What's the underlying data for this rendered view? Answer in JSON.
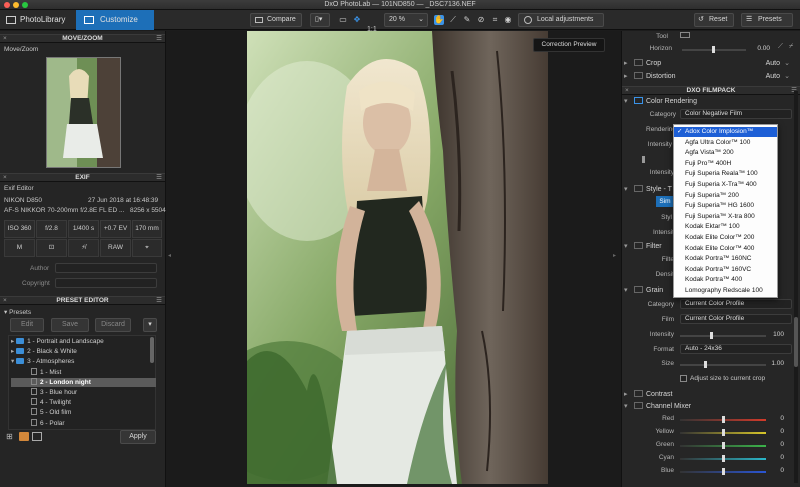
{
  "window": {
    "title": "DxO PhotoLab — 101ND850 — _DSC7136.NEF"
  },
  "toolbar": {
    "tab_library": "PhotoLibrary",
    "tab_customize": "Customize",
    "compare_label": "Compare",
    "zoom_fit": "1:1",
    "zoom_value": "20 %",
    "local_adjustments_label": "Local adjustments",
    "reset_label": "Reset",
    "presets_label": "Presets"
  },
  "move_zoom": {
    "header": "MOVE/ZOOM",
    "label": "Move/Zoom"
  },
  "exif": {
    "header": "EXIF",
    "editor_label": "Exif Editor",
    "camera": "NIKON D850",
    "date": "27 Jun 2018 at 16:48:39",
    "lens": "AF-S NIKKOR 70-200mm f/2.8E FL ED ...",
    "dimensions": "8256 x 5504",
    "iso": "ISO 360",
    "aperture": "f/2.8",
    "shutter": "1/400 s",
    "ev": "+0.7 EV",
    "focal": "170 mm",
    "mode_m": "M",
    "raw": "RAW",
    "author_label": "Author",
    "copyright_label": "Copyright"
  },
  "preset_editor": {
    "header": "PRESET EDITOR",
    "presets_label": "Presets",
    "edit_label": "Edit",
    "save_label": "Save",
    "discard_label": "Discard",
    "apply_label": "Apply",
    "tree": [
      {
        "label": "1 - Portrait and Landscape",
        "type": "folder",
        "expanded": false
      },
      {
        "label": "2 - Black & White",
        "type": "folder",
        "expanded": false
      },
      {
        "label": "3 - Atmospheres",
        "type": "folder",
        "expanded": true
      },
      {
        "label": "1 - Mist",
        "type": "preset"
      },
      {
        "label": "2 - London night",
        "type": "preset",
        "selected": true
      },
      {
        "label": "3 - Blue hour",
        "type": "preset"
      },
      {
        "label": "4 - Twilight",
        "type": "preset"
      },
      {
        "label": "5 - Old film",
        "type": "preset"
      },
      {
        "label": "6 - Polar",
        "type": "preset"
      }
    ]
  },
  "center": {
    "tooltip": "Correction Preview"
  },
  "right_panel": {
    "tool_label": "Tool",
    "horizon_label": "Horizon",
    "horizon_value": "0.00",
    "crop_label": "Crop",
    "crop_value": "Auto",
    "distortion_label": "Distortion",
    "distortion_value": "Auto",
    "filmpack_header": "DXO FILMPACK",
    "color_rendering_label": "Color Rendering",
    "category_label": "Category",
    "category_value": "Color Negative Film",
    "rendering_label": "Rendering",
    "intensity_label": "Intensity",
    "style_label": "Style - T",
    "style_button": "Sim",
    "style_sub": "Styl",
    "intensity2_label": "Intensit",
    "filter_label": "Filter",
    "filter_sub": "Filte",
    "density_label": "Densit",
    "grain_label": "Grain",
    "grain_category_label": "Category",
    "grain_category_value": "Current Color Profile",
    "film_label": "Film",
    "film_value": "Current Color Profile",
    "grain_intensity_label": "Intensity",
    "grain_intensity_value": "100",
    "format_label": "Format",
    "format_value": "Auto - 24x36",
    "size_label": "Size",
    "size_value": "1.00",
    "adjust_size_label": "Adjust size to current crop",
    "contrast_label": "Contrast",
    "channel_mixer_label": "Channel Mixer",
    "channels": [
      {
        "label": "Red",
        "value": "0",
        "color": "#d23a2a"
      },
      {
        "label": "Yellow",
        "value": "0",
        "color": "#d6c52a"
      },
      {
        "label": "Green",
        "value": "0",
        "color": "#3bb34a"
      },
      {
        "label": "Cyan",
        "value": "0",
        "color": "#2ab7c9"
      },
      {
        "label": "Blue",
        "value": "0",
        "color": "#2a55d2"
      }
    ]
  },
  "dropdown": {
    "items": [
      {
        "label": "Adox Color Implosion™",
        "selected": true
      },
      {
        "label": "Agfa Ultra Color™ 100"
      },
      {
        "label": "Agfa Vista™ 200"
      },
      {
        "label": "Fuji Pro™ 400H"
      },
      {
        "label": "Fuji Superia Reala™ 100"
      },
      {
        "label": "Fuji Superia X-Tra™ 400"
      },
      {
        "label": "Fuji Superia™ 200"
      },
      {
        "label": "Fuji Superia™ HG 1600"
      },
      {
        "label": "Fuji Superia™ X-tra 800"
      },
      {
        "label": "Kodak Ektar™ 100"
      },
      {
        "label": "Kodak Elite Color™ 200"
      },
      {
        "label": "Kodak Elite Color™ 400"
      },
      {
        "label": "Kodak Portra™ 160NC"
      },
      {
        "label": "Kodak Portra™ 160VC"
      },
      {
        "label": "Kodak Portra™ 400"
      },
      {
        "label": "Lomography Redscale 100"
      }
    ]
  },
  "colors": {
    "accent": "#1d6fb8",
    "selection": "#1d5fd6"
  }
}
